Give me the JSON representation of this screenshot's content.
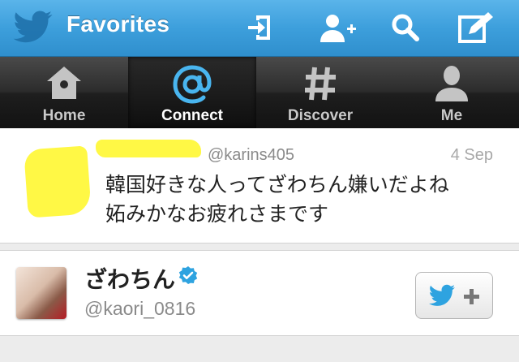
{
  "nav": {
    "title": "Favorites",
    "icons": [
      "twitter-bird-icon",
      "sign-in-icon",
      "add-user-icon",
      "search-icon",
      "compose-icon"
    ]
  },
  "tabs": [
    {
      "label": "Home",
      "icon": "home-icon",
      "active": false
    },
    {
      "label": "Connect",
      "icon": "at-icon",
      "active": true
    },
    {
      "label": "Discover",
      "icon": "hash-icon",
      "active": false
    },
    {
      "label": "Me",
      "icon": "person-icon",
      "active": false
    }
  ],
  "tweet": {
    "handle": "@karins405",
    "time": "4 Sep",
    "line1": "韓国好きな人ってざわちん嫌いだよね",
    "line2": "妬みかなお疲れさまです"
  },
  "profile": {
    "name": "ざわちん",
    "handle": "@kaori_0816",
    "verified": true
  },
  "colors": {
    "titlebar": "#3d9fdc",
    "verified": "#2ea3e0",
    "follow_bird": "#2ea3e0",
    "redaction": "#fff845"
  }
}
